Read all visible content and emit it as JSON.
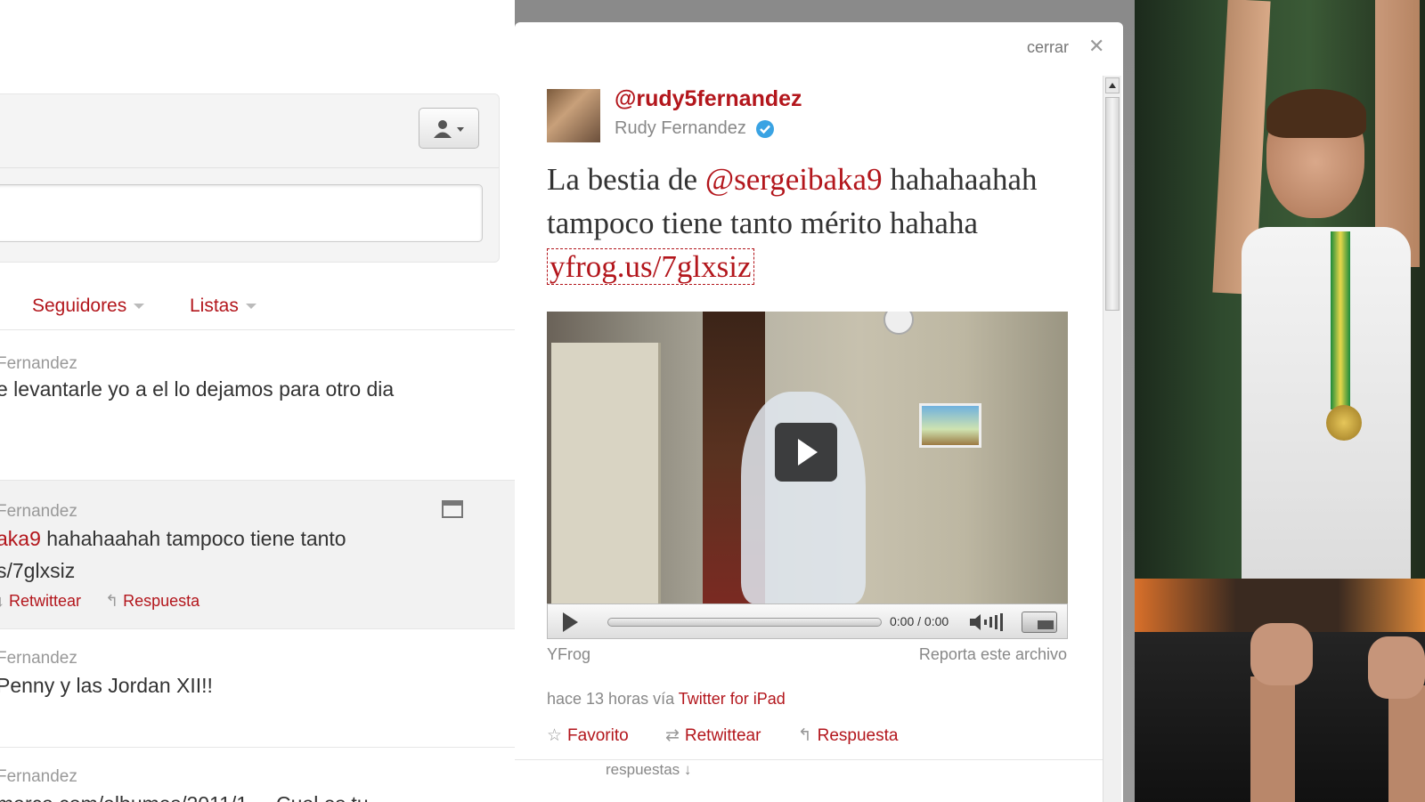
{
  "timeline": {
    "tabs": [
      {
        "label": "Seguidores"
      },
      {
        "label": "Listas"
      }
    ],
    "tweets": [
      {
        "name": "Fernandez",
        "text": "e levantarle yo a el lo dejamos para otro dia"
      },
      {
        "name": "Fernandez",
        "text_mention": "aka9",
        "text": " hahahaahah tampoco tiene tanto",
        "link": "s/7glxsiz",
        "retweet": "Retwittear",
        "reply": "Respuesta"
      },
      {
        "name": "Fernandez",
        "text": " Penny y las Jordan XII!!"
      },
      {
        "name": "Fernandez",
        "text": "marca.com/albumes/2011/1 ... Cual es tu"
      }
    ]
  },
  "modal": {
    "close_label": "cerrar",
    "close_icon": "close-icon",
    "handle": "@rudy5fernandez",
    "fullname": "Rudy Fernandez",
    "tweet": {
      "prefix": "La bestia de ",
      "mention": "@sergeibaka9",
      "middle": " hahahaahah tampoco tiene tanto mérito hahaha ",
      "link": "yfrog.us/7glxsiz"
    },
    "video": {
      "time": "0:00 / 0:00"
    },
    "source": "YFrog",
    "report": "Reporta este archivo",
    "meta_prefix": "hace 13 horas vía ",
    "meta_app": "Twitter for iPad",
    "actions": {
      "favorite": "Favorito",
      "retweet": "Retwittear",
      "reply": "Respuesta"
    },
    "replies_label": "respuestas ↓"
  },
  "colors": {
    "accent": "#b3161c",
    "muted": "#888888",
    "verified": "#3aa3e3"
  }
}
